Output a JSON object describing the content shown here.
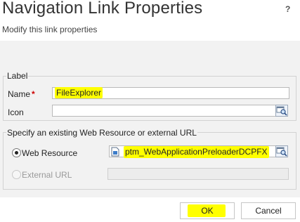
{
  "dialog": {
    "title": "Navigation Link Properties",
    "help_icon": "?",
    "subtitle": "Modify this link properties"
  },
  "label_section": {
    "legend": "Label",
    "name_label": "Name",
    "required_mark": "*",
    "name_value": "FileExplorer",
    "icon_label": "Icon",
    "icon_value": ""
  },
  "resource_section": {
    "legend": "Specify an existing Web Resource or external URL",
    "web_resource_label": "Web Resource",
    "web_resource_value": "ptm_WebApplicationPreloaderDCPFX",
    "web_resource_selected": true,
    "external_url_label": "External URL",
    "external_url_value": ""
  },
  "footer": {
    "ok_label": "OK",
    "cancel_label": "Cancel"
  },
  "colors": {
    "highlight": "#ffff00",
    "required": "#cc0000",
    "panel_bg": "#f2f2f2"
  },
  "icons": [
    "help-icon",
    "lookup-icon",
    "web-resource-icon"
  ]
}
